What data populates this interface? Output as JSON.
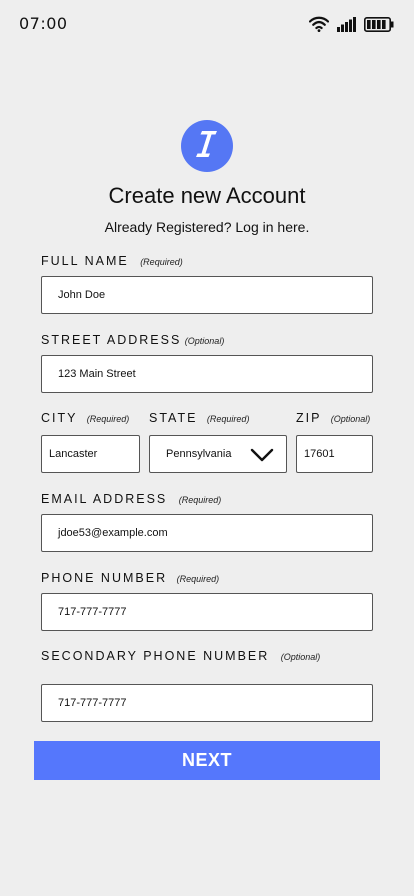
{
  "status_bar": {
    "time": "07:00",
    "icons": [
      "wifi-icon",
      "signal-icon",
      "battery-icon"
    ]
  },
  "logo": {
    "icon": "logo-icon",
    "color": "#5577f4"
  },
  "header": {
    "title": "Create new Account",
    "subtitle": "Already Registered? Log in here."
  },
  "form": {
    "full_name": {
      "label": "FULL NAME",
      "hint": "(Required)",
      "value": "John Doe"
    },
    "street_address": {
      "label": "STREET ADDRESS",
      "hint": "(Optional)",
      "value": "123 Main Street"
    },
    "city": {
      "label": "CITY",
      "hint": "(Required)",
      "value": "Lancaster"
    },
    "state": {
      "label": "STATE",
      "hint": "(Required)",
      "value": "Pennsylvania",
      "icon": "chevron-down-icon"
    },
    "zip": {
      "label": "ZIP",
      "hint": "(Optional)",
      "value": "17601"
    },
    "email": {
      "label": "EMAIL ADDRESS",
      "hint": "(Required)",
      "value": "jdoe53@example.com"
    },
    "phone": {
      "label": "PHONE NUMBER",
      "hint": "(Required)",
      "value": "717-777-7777"
    },
    "secondary_phone": {
      "label": "SECONDARY PHONE NUMBER",
      "hint": "(Optional)",
      "value": "717-777-7777"
    }
  },
  "next_button": {
    "label": "NEXT",
    "color": "#5577fc"
  }
}
